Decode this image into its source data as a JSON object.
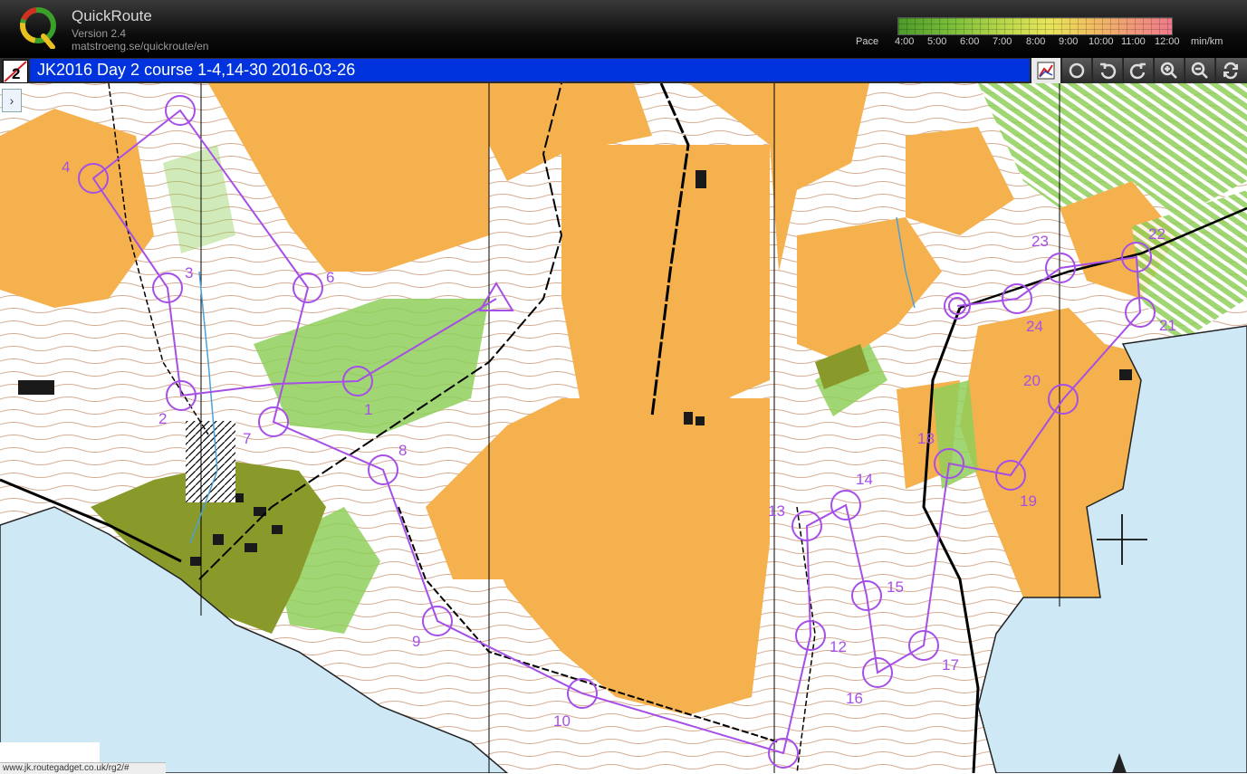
{
  "app": {
    "name": "QuickRoute",
    "version": "Version 2.4",
    "url": "matstroeng.se/quickroute/en",
    "logo_letter": "Q"
  },
  "pace_scale": {
    "label": "Pace",
    "ticks": [
      "4:00",
      "5:00",
      "6:00",
      "7:00",
      "8:00",
      "9:00",
      "10:00",
      "11:00",
      "12:00"
    ],
    "unit": "min/km"
  },
  "route": {
    "course_badge": "2",
    "title": "JK2016 Day 2 course 1-4,14-30 2016-03-26"
  },
  "toolbar": [
    {
      "name": "route-overlay-icon"
    },
    {
      "name": "circle-icon"
    },
    {
      "name": "undo-icon"
    },
    {
      "name": "redo-icon"
    },
    {
      "name": "zoom-in-icon"
    },
    {
      "name": "zoom-out-icon"
    },
    {
      "name": "refresh-icon"
    }
  ],
  "sidebar": {
    "expand_glyph": "›"
  },
  "map": {
    "controls": [
      "1",
      "2",
      "3",
      "4",
      "6",
      "7",
      "8",
      "9",
      "10",
      "12",
      "13",
      "14",
      "15",
      "16",
      "17",
      "18",
      "19",
      "20",
      "21",
      "22",
      "23",
      "24"
    ],
    "colors": {
      "open_land": "#f4b14e",
      "forest": "#ffffff",
      "green": "#8fcf5a",
      "water": "#cfe8f6",
      "course": "#a64fe6",
      "contour": "#b06a3a",
      "olive": "#8a9a2a"
    }
  },
  "status_url": "www.jk.routegadget.co.uk/rg2/#"
}
